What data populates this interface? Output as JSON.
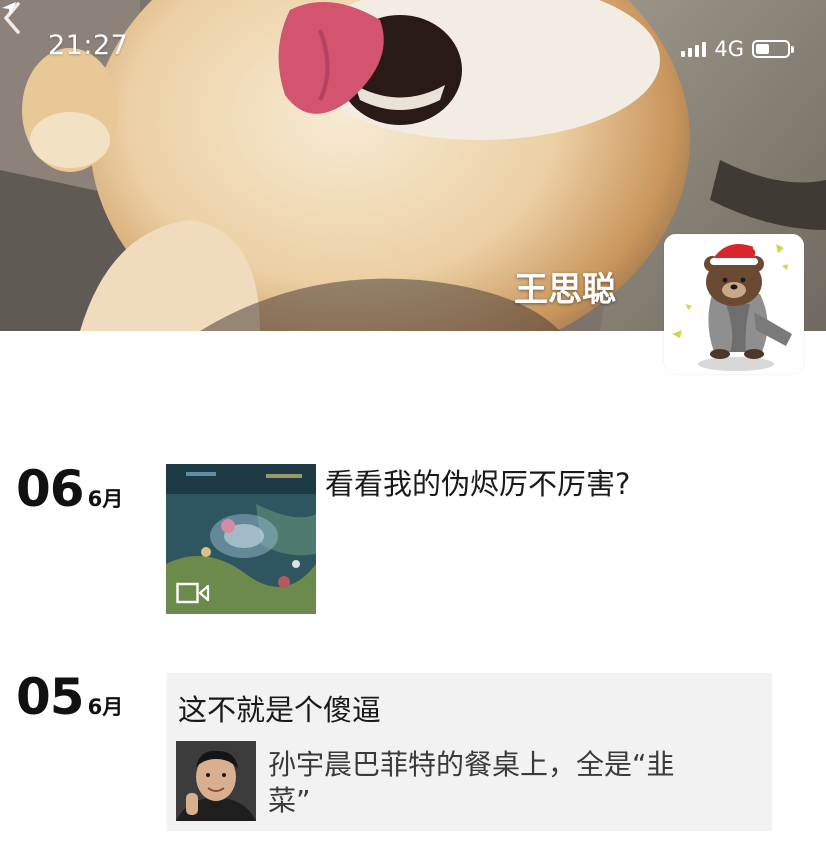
{
  "status_bar": {
    "time": "21:27",
    "network": "4G"
  },
  "profile": {
    "name": "王思聪"
  },
  "posts": [
    {
      "day": "06",
      "month": "6月",
      "text": "看看我的伪烬厉不厉害?",
      "media": "video"
    },
    {
      "day": "05",
      "month": "6月",
      "text": "这不就是个傻逼",
      "shared_link": {
        "title": "孙宇晨巴菲特的餐桌上，全是“韭菜”"
      }
    }
  ]
}
